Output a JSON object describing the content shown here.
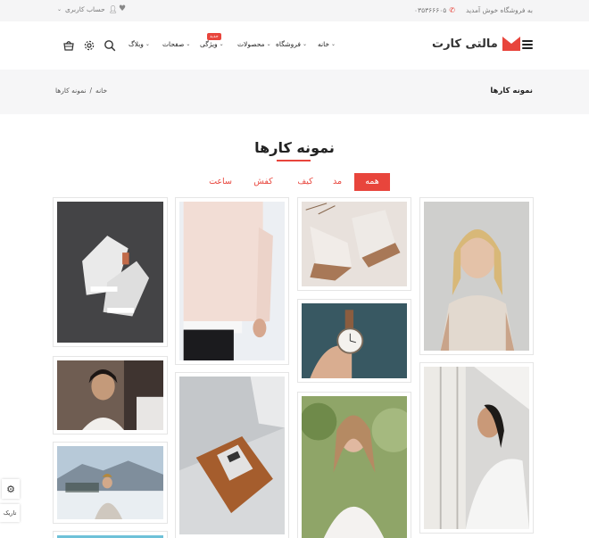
{
  "topbar": {
    "welcome": "به فروشگاه خوش آمدید",
    "phone": "۰۳۵۳۶۶۶۰۵",
    "account": "حساب کاربری"
  },
  "header": {
    "logo_text": "مالتی کارت",
    "nav": [
      {
        "label": "خانه",
        "has_dropdown": true
      },
      {
        "label": "فروشگاه",
        "has_dropdown": true
      },
      {
        "label": "محصولات",
        "has_dropdown": true
      },
      {
        "label": "ویژگی",
        "has_dropdown": true,
        "badge": "جدید"
      },
      {
        "label": "صفحات",
        "has_dropdown": true
      },
      {
        "label": "وبلاگ",
        "has_dropdown": true
      }
    ],
    "icons": [
      "search-icon",
      "gear-icon",
      "cart-icon",
      "menu-icon"
    ],
    "accent": "#e8453c"
  },
  "page_header": {
    "title": "نمونه کارها",
    "breadcrumb": [
      "خانه",
      "نمونه کارها"
    ],
    "separator": "/"
  },
  "portfolio": {
    "title": "نمونه کارها",
    "filters": [
      {
        "label": "همه",
        "active": true
      },
      {
        "label": "مد",
        "active": false
      },
      {
        "label": "کیف",
        "active": false
      },
      {
        "label": "کفش",
        "active": false
      },
      {
        "label": "ساعت",
        "active": false
      }
    ]
  },
  "side_panel": {
    "dark_label": "تاریک"
  }
}
